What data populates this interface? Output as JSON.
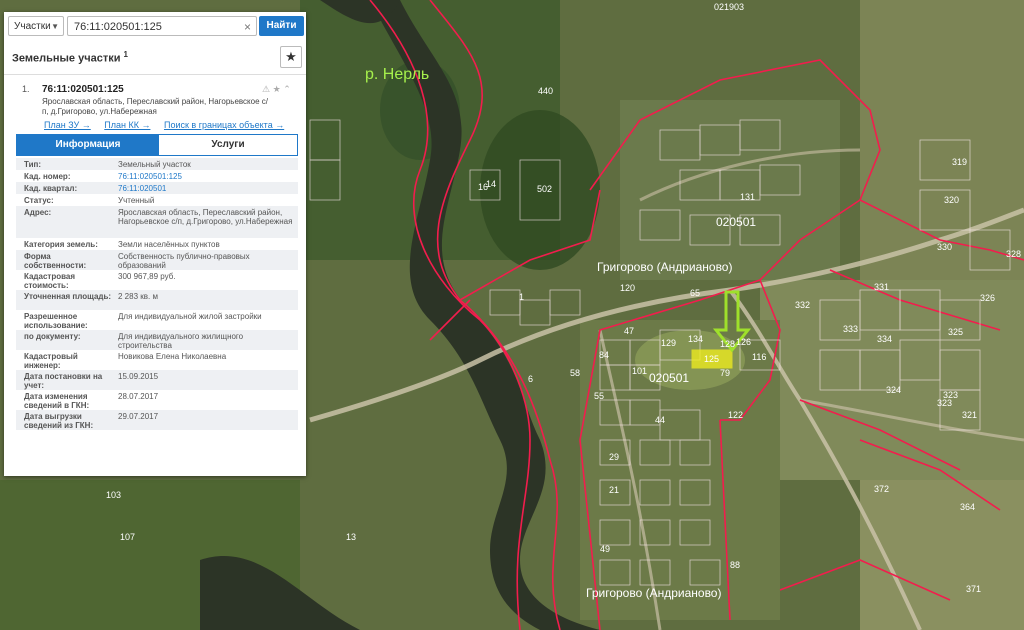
{
  "search": {
    "category_label": "Участки",
    "query": "76:11:020501:125",
    "find_label": "Найти"
  },
  "panel": {
    "title": "Земельные участки",
    "count": "1",
    "bookmark_icon": "star-icon"
  },
  "result": {
    "index": "1.",
    "cad_number": "76:11:020501:125",
    "address": "Ярославская область, Переславский район, Нагорьевское с/п, д.Григорово, ул.Набережная",
    "links": [
      "План ЗУ →",
      "План КК →",
      "Поиск в границах объекта →"
    ],
    "icons": [
      "warning-icon",
      "star-icon",
      "collapse-icon"
    ]
  },
  "tabs": {
    "info": "Информация",
    "services": "Услуги"
  },
  "details": [
    {
      "label": "Тип:",
      "value": "Земельный участок"
    },
    {
      "label": "Кад. номер:",
      "value": "76:11:020501:125",
      "link": true
    },
    {
      "label": "Кад. квартал:",
      "value": "76:11:020501",
      "link": true
    },
    {
      "label": "Статус:",
      "value": "Учтенный"
    },
    {
      "label": "Адрес:",
      "value": "Ярославская область, Переславский район, Нагорьевское с/п, д.Григорово, ул.Набережная"
    },
    {
      "label": "Категория земель:",
      "value": "Земли населённых пунктов"
    },
    {
      "label": "Форма собственности:",
      "value": "Собственность публично-правовых образований"
    },
    {
      "label": "Кадастровая стоимость:",
      "value": "300 967,89 руб."
    },
    {
      "label": "Уточненная площадь:",
      "value": "2 283 кв. м"
    },
    {
      "label": "Разрешенное использование:",
      "value": "Для индивидуальной жилой застройки"
    },
    {
      "label": "по документу:",
      "value": "Для индивидуального жилищного строительства"
    },
    {
      "label": "Кадастровый инженер:",
      "value": "Новикова Елена Николаевна"
    },
    {
      "label": "Дата постановки на учет:",
      "value": "15.09.2015"
    },
    {
      "label": "Дата изменения сведений в ГКН:",
      "value": "28.07.2017"
    },
    {
      "label": "Дата выгрузки сведений из ГКН:",
      "value": "29.07.2017"
    }
  ],
  "map": {
    "river_label": "р. Нерль",
    "places": [
      "Григорово (Андрианово)",
      "Григорово (Андрианово)"
    ],
    "quarters": [
      "020501",
      "020501",
      "021903"
    ],
    "parcel_numbers": [
      "440",
      "502",
      "16",
      "1",
      "319",
      "320",
      "330",
      "328",
      "331",
      "326",
      "333",
      "325",
      "334",
      "323",
      "324",
      "332",
      "372",
      "364",
      "371",
      "122",
      "116",
      "79",
      "129",
      "134",
      "128",
      "47",
      "84",
      "58",
      "101",
      "55",
      "44",
      "21",
      "29",
      "49",
      "88",
      "13",
      "103",
      "107",
      "65",
      "120",
      "14",
      "126",
      "131",
      "6",
      "321",
      "323"
    ],
    "highlighted_parcel": "125",
    "colors": {
      "boundary": "#f21d4d",
      "highlight": "#f2ef1c",
      "arrow": "#9fe02b"
    }
  }
}
